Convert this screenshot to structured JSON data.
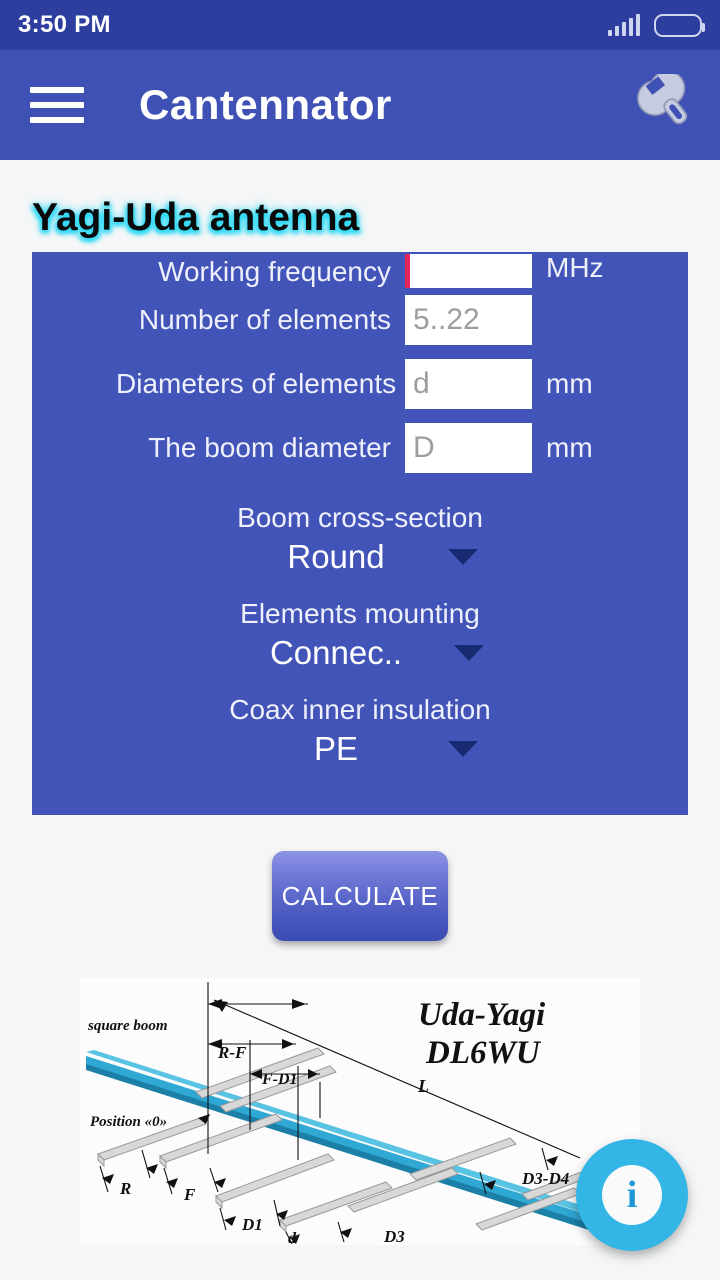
{
  "status_bar": {
    "time": "3:50 PM",
    "signal_icon": "signal-bars-icon",
    "battery_icon": "battery-icon"
  },
  "app_bar": {
    "menu_icon": "hamburger-menu-icon",
    "title": "Cantennator",
    "settings_icon": "wrench-icon"
  },
  "page": {
    "title": "Yagi-Uda antenna",
    "title_glow_color": "#25d7f5",
    "background": "#f5f6f7"
  },
  "form": {
    "panel_color": "#4254b8",
    "fields": [
      {
        "label": "Working frequency",
        "placeholder": "",
        "value": "",
        "unit": "MHz",
        "focused": true,
        "caret_color": "#e8245f"
      },
      {
        "label": "Number of elements",
        "placeholder": "5..22",
        "value": "",
        "unit": "",
        "focused": false
      },
      {
        "label": "Diameters of elements",
        "placeholder": "d",
        "value": "",
        "unit": "mm",
        "focused": false
      },
      {
        "label": "The boom diameter",
        "placeholder": "D",
        "value": "",
        "unit": "mm",
        "focused": false
      }
    ],
    "selects": [
      {
        "label": "Boom cross-section",
        "value": "Round",
        "icon": "chevron-down-icon"
      },
      {
        "label": "Elements mounting",
        "value": "Connec..",
        "icon": "chevron-down-icon"
      },
      {
        "label": "Coax inner insulation",
        "value": "PE",
        "icon": "chevron-down-icon"
      }
    ]
  },
  "actions": {
    "calculate_label": "CALCULATE"
  },
  "diagram": {
    "title_line1": "Uda-Yagi",
    "title_line2": "DL6WU",
    "boom_label": "square boom",
    "position_label": "Position «0»",
    "dim_rf": "R-F",
    "dim_fd1": "F-D1",
    "dim_l": "L",
    "dim_r": "R",
    "dim_f": "F",
    "dim_d1": "D1",
    "dim_d": "d",
    "dim_d3": "D3",
    "dim_d3d4": "D3-D4",
    "boom_color": "#2196c4"
  },
  "fab": {
    "icon": "info-icon",
    "glyph": "i",
    "color": "#33b5e5"
  }
}
